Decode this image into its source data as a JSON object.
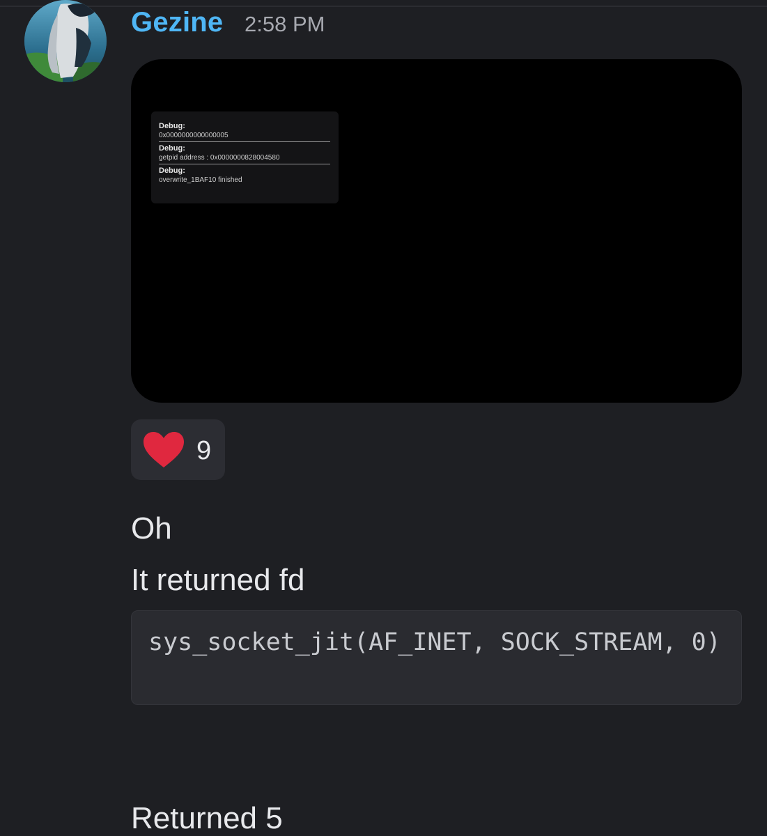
{
  "message": {
    "author": "Gezine",
    "timestamp": "2:58 PM",
    "attachment": {
      "debug_entries": [
        {
          "label": "Debug:",
          "value": "0x0000000000000005"
        },
        {
          "label": "Debug:",
          "value": "getpid address : 0x0000000828004580"
        },
        {
          "label": "Debug:",
          "value": "overwrite_1BAF10 finished"
        }
      ]
    },
    "reaction": {
      "icon": "heart-icon",
      "color": "#e0283f",
      "count": "9"
    },
    "lines": {
      "oh": "Oh",
      "returned_fd": "It returned fd",
      "code": "sys_socket_jit(AF_INET, SOCK_STREAM, 0)",
      "returned_5": "Returned 5"
    }
  },
  "colors": {
    "background": "#1e1f23",
    "username": "#4fb6f5",
    "timestamp": "#a7a9b0",
    "reaction_bg": "#2c2d33",
    "code_bg": "#2a2b30"
  }
}
